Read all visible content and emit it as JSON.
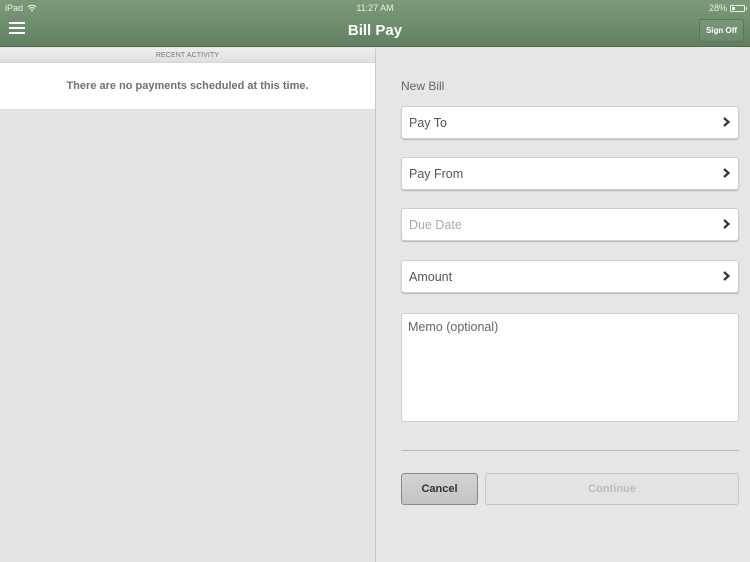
{
  "status_bar": {
    "device": "iPad",
    "time": "11:27 AM",
    "battery": "28%",
    "battery_level": 0.28
  },
  "header": {
    "title": "Bill Pay",
    "sign_off_label": "Sign Off",
    "menu_icon": "hamburger-menu-icon"
  },
  "left_pane": {
    "section_header": "RECENT ACTIVITY",
    "empty_message": "There are no payments scheduled at this time."
  },
  "right_pane": {
    "section_label": "New Bill",
    "fields": [
      {
        "label": "Pay To",
        "placeholder": false,
        "icon": "chevron-right-icon"
      },
      {
        "label": "Pay From",
        "placeholder": false,
        "icon": "chevron-right-icon"
      },
      {
        "label": "Due Date",
        "placeholder": true,
        "icon": "chevron-right-icon"
      },
      {
        "label": "Amount",
        "placeholder": false,
        "icon": "chevron-right-icon"
      }
    ],
    "memo": {
      "value": "",
      "placeholder": "Memo (optional)"
    },
    "buttons": {
      "cancel": "Cancel",
      "continue": "Continue",
      "continue_enabled": false
    }
  },
  "colors": {
    "header_green": "#6e8e6e",
    "pane_background": "#e6e6e6"
  }
}
